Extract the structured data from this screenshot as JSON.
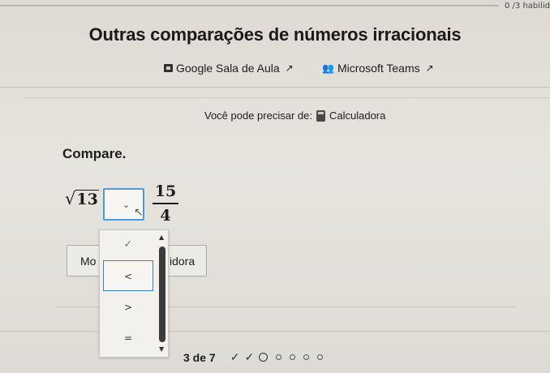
{
  "header": {
    "progress": "0 /3 habilida"
  },
  "title": "Outras comparações de números irracionais",
  "share": {
    "classroom_label": "Google Sala de Aula",
    "teams_label": "Microsoft Teams",
    "external_glyph": "↗"
  },
  "tools": {
    "need_label": "Você pode precisar de:",
    "calculator_label": "Calculadora"
  },
  "problem": {
    "instruction": "Compare.",
    "left_radical": "√",
    "left_radicand": "13",
    "right_numerator": "15",
    "right_denominator": "4",
    "select_chevron": "⌄"
  },
  "buttons": {
    "left_partial": "Mo",
    "right_partial": "idora"
  },
  "dropdown": {
    "options": [
      "✓",
      "<",
      ">",
      "="
    ],
    "scroll_up": "▲",
    "scroll_down": "▼"
  },
  "pager": {
    "counter": "3 de 7",
    "completed_marks": [
      "✓",
      "✓"
    ],
    "total_dots": 7
  },
  "icons": {
    "classroom": "google-classroom-icon",
    "teams": "microsoft-teams-icon",
    "calculator": "calculator-icon",
    "external": "external-link-icon"
  }
}
